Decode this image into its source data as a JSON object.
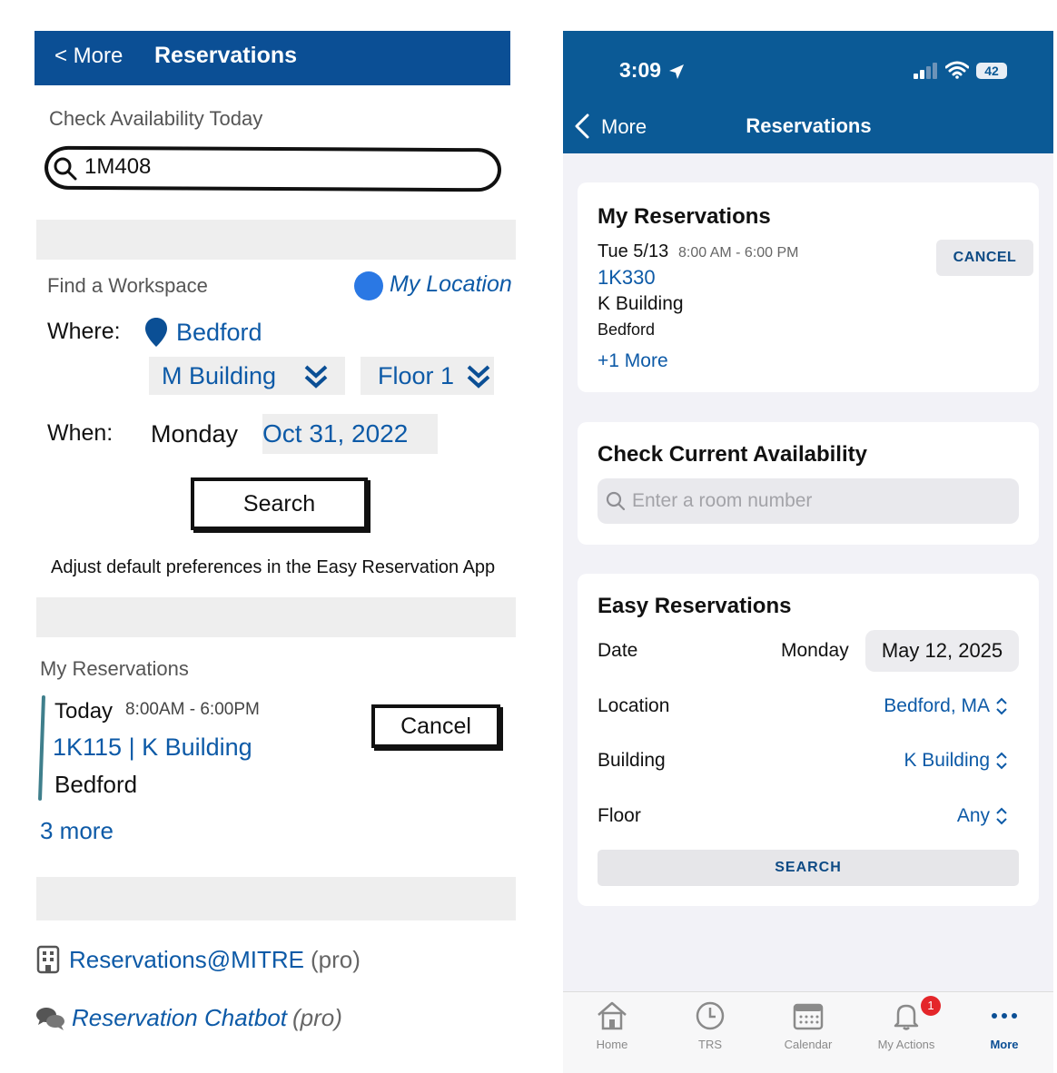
{
  "mockup": {
    "header": {
      "back_label": "< More",
      "title": "Reservations"
    },
    "check_availability": {
      "heading": "Check Availability Today",
      "search_value": "1M408"
    },
    "find_workspace": {
      "heading": "Find a Workspace",
      "my_location_label": "My Location",
      "where_label": "Where:",
      "where_value": "Bedford",
      "building_value": "M Building",
      "floor_value": "Floor 1",
      "when_label": "When:",
      "day_value": "Monday",
      "date_value": "Oct 31, 2022",
      "search_label": "Search",
      "preferences_note": "Adjust default preferences in the Easy Reservation App"
    },
    "my_reservations": {
      "heading": "My Reservations",
      "day": "Today",
      "time": "8:00AM - 6:00PM",
      "room": "1K115 | K Building",
      "site": "Bedford",
      "cancel_label": "Cancel",
      "more_link": "3 more"
    },
    "links": {
      "reservations_label": "Reservations@MITRE",
      "reservations_suffix": "(pro)",
      "chatbot_label": "Reservation Chatbot",
      "chatbot_suffix": "(pro)"
    }
  },
  "phone": {
    "status_bar": {
      "time": "3:09",
      "battery": "42"
    },
    "nav": {
      "back_label": "More",
      "title": "Reservations"
    },
    "my_reservations": {
      "heading": "My Reservations",
      "date": "Tue 5/13",
      "time": "8:00 AM - 6:00 PM",
      "room": "1K330",
      "building": "K Building",
      "site": "Bedford",
      "cancel_label": "CANCEL",
      "more_link": "+1 More"
    },
    "check_current": {
      "heading": "Check Current Availability",
      "placeholder": "Enter a room number"
    },
    "easy_reservations": {
      "heading": "Easy Reservations",
      "date_label": "Date",
      "day_value": "Monday",
      "date_value": "May 12, 2025",
      "location_label": "Location",
      "location_value": "Bedford, MA",
      "building_label": "Building",
      "building_value": "K Building",
      "floor_label": "Floor",
      "floor_value": "Any",
      "search_label": "SEARCH"
    },
    "tabs": [
      {
        "label": "Home",
        "icon": "home-icon"
      },
      {
        "label": "TRS",
        "icon": "clock-icon"
      },
      {
        "label": "Calendar",
        "icon": "calendar-icon"
      },
      {
        "label": "My Actions",
        "icon": "bell-icon",
        "badge": "1"
      },
      {
        "label": "More",
        "icon": "more-dots-icon"
      }
    ],
    "colors": {
      "header_blue": "#0b5a96",
      "link_blue": "#0d5aa7",
      "badge_red": "#e4262a"
    }
  }
}
